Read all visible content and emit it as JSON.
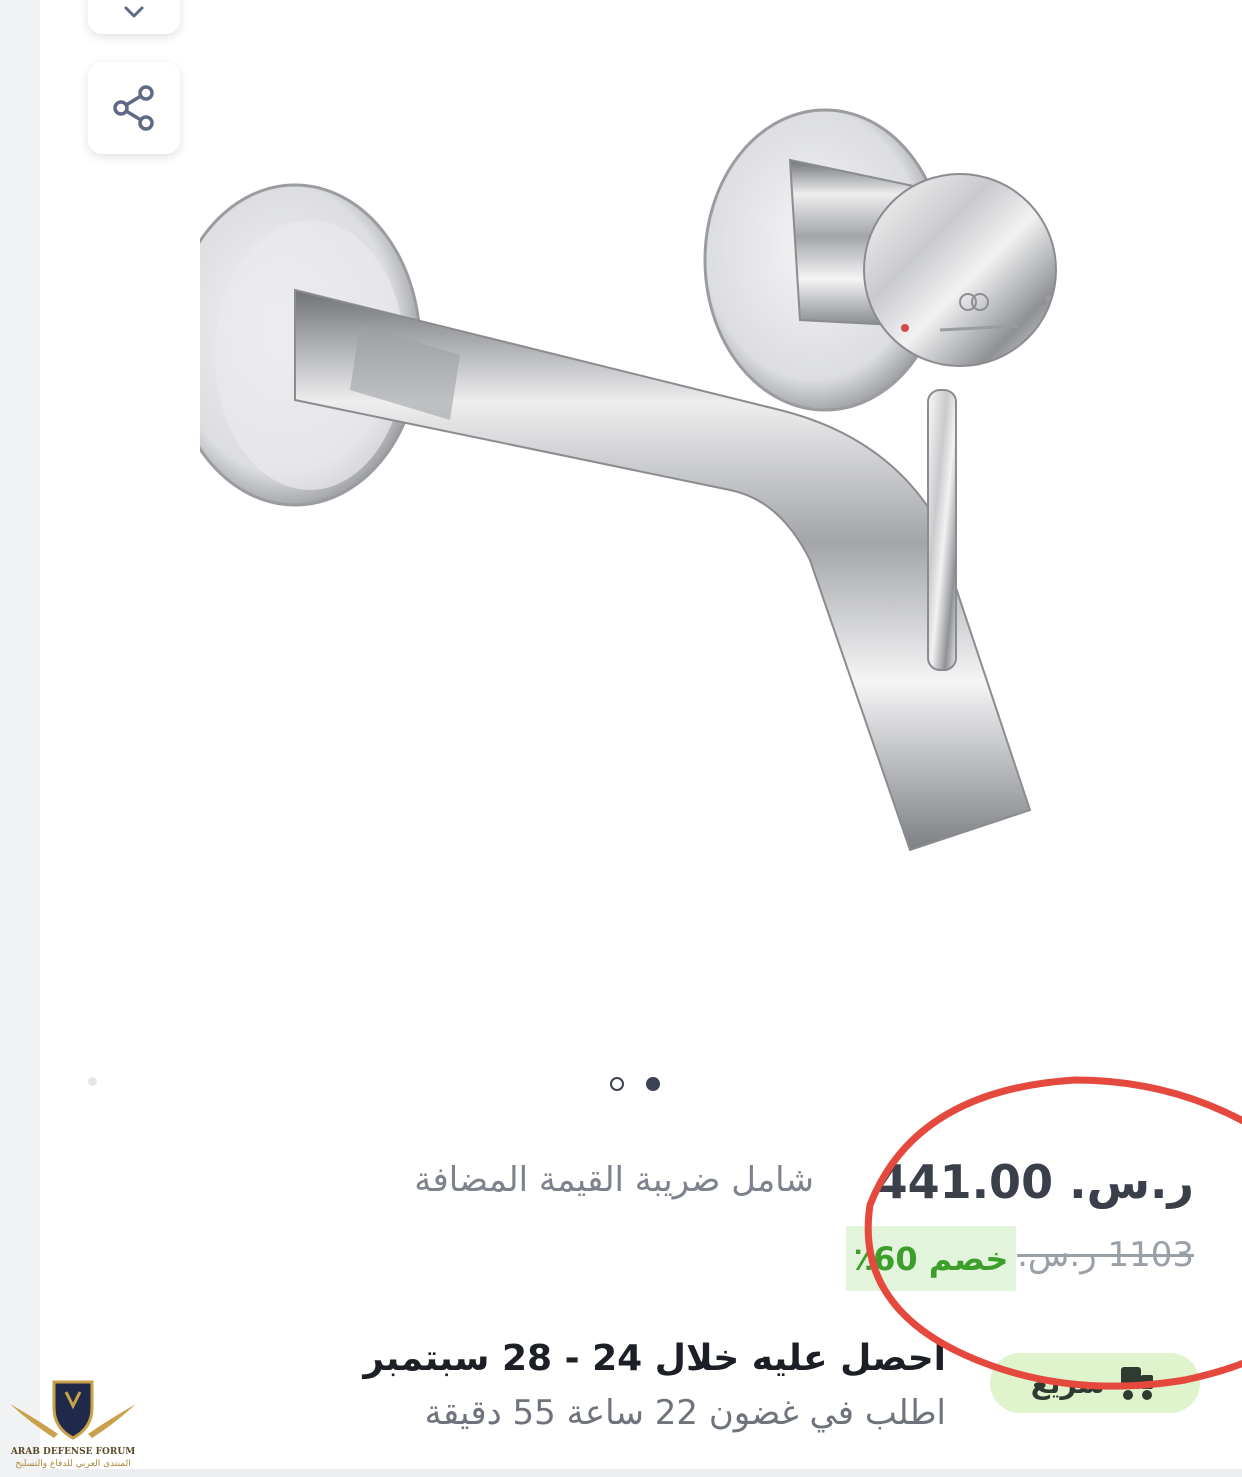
{
  "product": {
    "price": "ر.س. 441.00",
    "vat_note": "شامل ضريبة القيمة المضافة",
    "old_price": "1103 ر.س.",
    "discount_label": "خصم 60٪"
  },
  "gallery": {
    "image_icon": "wall-mounted-faucet",
    "slide_count": 2,
    "active_slide": 2
  },
  "delivery": {
    "title": "احصل عليه خلال 24 - 28 سبتمبر",
    "subtitle": "اطلب في غضون 22 ساعة 55 دقيقة",
    "express_label": "سريع"
  },
  "watermark": {
    "en": "ARAB DEFENSE FORUM",
    "ar": "المنتدى العربي للدفاع والتسليح"
  },
  "colors": {
    "discount_green": "#3e9e2b",
    "highlight_red": "#e5483d",
    "express_bg": "#dff4cd"
  },
  "icons": {
    "share": "share-icon",
    "wishlist": "chevron-down-icon",
    "express": "truck-icon"
  }
}
